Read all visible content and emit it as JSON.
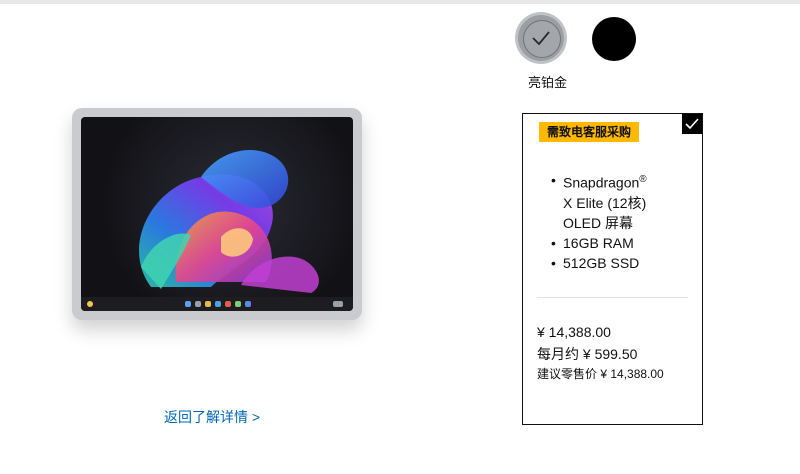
{
  "color_selector": {
    "selected_label": "亮铂金",
    "options": [
      {
        "name": "亮铂金",
        "color": "#9b9ea3",
        "selected": true
      },
      {
        "name": "",
        "color": "#000000",
        "selected": false
      }
    ]
  },
  "product_image": {
    "icon": "surface-tablet-image"
  },
  "back_link": "返回了解详情 >",
  "config": {
    "badge": "需致电客服采购",
    "selected": true,
    "specs": [
      {
        "line1": "Snapdragon",
        "reg": "®",
        "line2": "X Elite (12核)",
        "line3": "OLED 屏幕"
      },
      {
        "text": "16GB RAM"
      },
      {
        "text": "512GB SSD"
      }
    ],
    "bullet": "•",
    "price": "¥ 14,388.00",
    "monthly": "每月约 ¥ 599.50",
    "msrp": "建议零售价 ¥ 14,388.00"
  },
  "colors": {
    "link": "#0067b8",
    "badge": "#ffb900",
    "border": "#111111"
  }
}
